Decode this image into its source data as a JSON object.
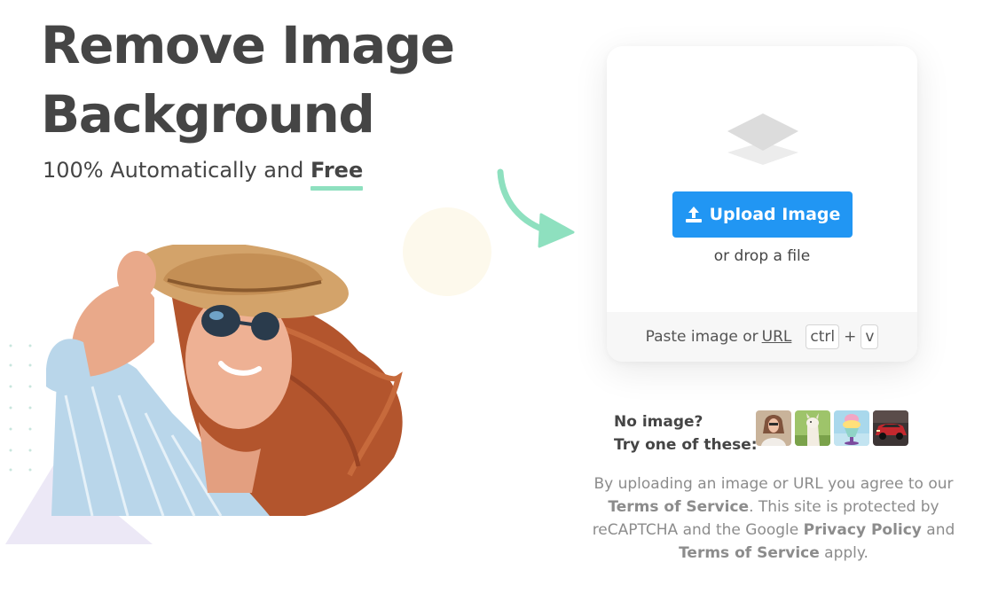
{
  "hero": {
    "title_line1": "Remove Image",
    "title_line2": "Background",
    "subtitle_prefix": "100% Automatically and ",
    "subtitle_highlight": "Free"
  },
  "upload": {
    "button_label": "Upload Image",
    "drop_text": "or drop a file",
    "paste_text": "Paste image or",
    "url_link": "URL",
    "key_ctrl": "ctrl",
    "key_plus": "+",
    "key_v": "v"
  },
  "samples": {
    "label_line1": "No image?",
    "label_line2": "Try one of these:",
    "items": [
      {
        "icon": "sample-woman-thumbnail"
      },
      {
        "icon": "sample-llama-thumbnail"
      },
      {
        "icon": "sample-ice-cream-thumbnail"
      },
      {
        "icon": "sample-car-thumbnail"
      }
    ]
  },
  "legal": {
    "part1": "By uploading an image or URL you agree to our ",
    "terms1": "Terms of Service",
    "part2": ". This site is protected by reCAPTCHA and the Google ",
    "privacy": "Privacy Policy",
    "part3": " and ",
    "terms2": "Terms of Service",
    "part4": " apply."
  },
  "colors": {
    "accent_button": "#2196f3",
    "underline_green": "#8ee0bf",
    "arrow_green": "#8ee0bf",
    "title_text": "#454545",
    "legal_text": "#8c8c8c"
  }
}
